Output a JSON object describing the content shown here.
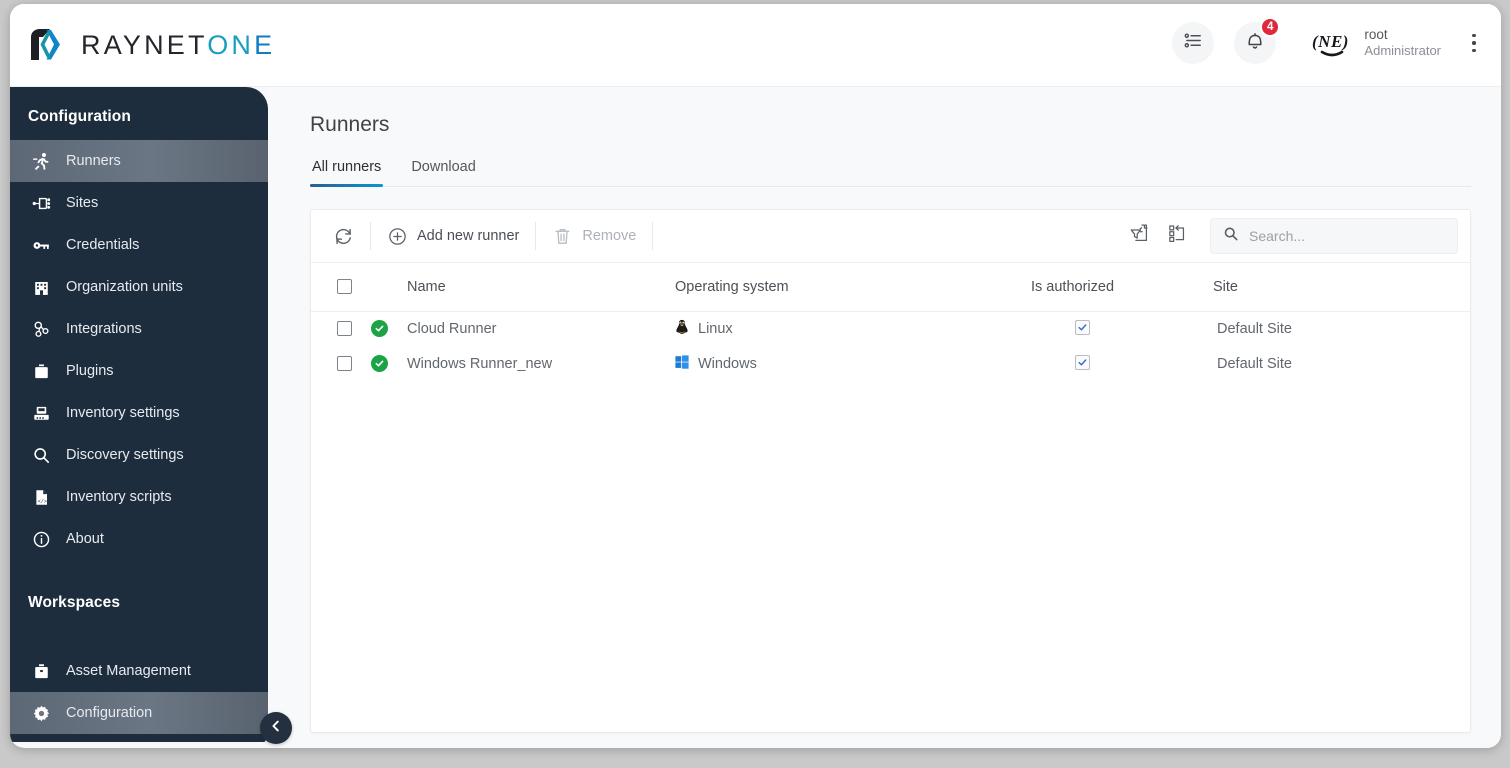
{
  "brand": {
    "name_part1": "RAYNET",
    "name_part2": "ON",
    "name_part3": "E",
    "logo_icon": "raynet-logo-icon",
    "color_dark": "#24262b",
    "color_teal": "#179fc0",
    "color_blue": "#0f7dc2"
  },
  "header": {
    "tasks_icon": "task-list-icon",
    "notifications_icon": "bell-icon",
    "notification_count": "4",
    "badge_color": "#e0273c",
    "avatar_icon": "user-avatar-icon",
    "user_name": "root",
    "user_role": "Administrator",
    "menu_icon": "kebab-menu-icon"
  },
  "sidebar": {
    "configuration_title": "Configuration",
    "workspaces_title": "Workspaces",
    "collapse_icon": "chevron-left-icon",
    "config_items": [
      {
        "label": "Runners",
        "icon": "runner-icon",
        "active": true
      },
      {
        "label": "Sites",
        "icon": "sites-network-icon",
        "active": false
      },
      {
        "label": "Credentials",
        "icon": "key-icon",
        "active": false
      },
      {
        "label": "Organization units",
        "icon": "building-icon",
        "active": false
      },
      {
        "label": "Integrations",
        "icon": "integrations-icon",
        "active": false
      },
      {
        "label": "Plugins",
        "icon": "plugin-briefcase-icon",
        "active": false
      },
      {
        "label": "Inventory settings",
        "icon": "inventory-settings-icon",
        "active": false
      },
      {
        "label": "Discovery settings",
        "icon": "magnifier-icon",
        "active": false
      },
      {
        "label": "Inventory scripts",
        "icon": "script-file-icon",
        "active": false
      },
      {
        "label": "About",
        "icon": "info-circle-icon",
        "active": false
      }
    ],
    "workspace_items": [
      {
        "label": "Asset Management",
        "icon": "briefcase-icon",
        "active": false
      },
      {
        "label": "Configuration",
        "icon": "gear-icon",
        "active": true
      }
    ]
  },
  "main": {
    "page_title": "Runners",
    "tabs": [
      {
        "label": "All runners",
        "active": true
      },
      {
        "label": "Download",
        "active": false
      }
    ],
    "tab_underline_color": "#0d93d4"
  },
  "toolbar": {
    "refresh_icon": "refresh-icon",
    "add_icon": "plus-circle-icon",
    "add_label": "Add new runner",
    "remove_icon": "trash-icon",
    "remove_label": "Remove",
    "remove_disabled": true,
    "clear_filter_icon": "clear-filter-icon",
    "reset_layout_icon": "reset-columns-icon",
    "search_icon": "search-icon",
    "search_placeholder": "Search...",
    "search_value": ""
  },
  "table": {
    "select_all_checked": false,
    "columns": [
      {
        "key": "check",
        "label": ""
      },
      {
        "key": "status",
        "label": ""
      },
      {
        "key": "name",
        "label": "Name"
      },
      {
        "key": "os",
        "label": "Operating system"
      },
      {
        "key": "auth",
        "label": "Is authorized"
      },
      {
        "key": "site",
        "label": "Site"
      }
    ],
    "rows": [
      {
        "selected": false,
        "status_icon": "status-ok-check-icon",
        "status_color": "#1ba345",
        "name": "Cloud Runner",
        "os_icon": "linux-penguin-icon",
        "os": "Linux",
        "is_authorized": true,
        "site": "Default Site"
      },
      {
        "selected": false,
        "status_icon": "status-ok-check-icon",
        "status_color": "#1ba345",
        "name": "Windows Runner_new",
        "os_icon": "windows-logo-icon",
        "os": "Windows",
        "is_authorized": true,
        "site": "Default Site"
      }
    ]
  }
}
